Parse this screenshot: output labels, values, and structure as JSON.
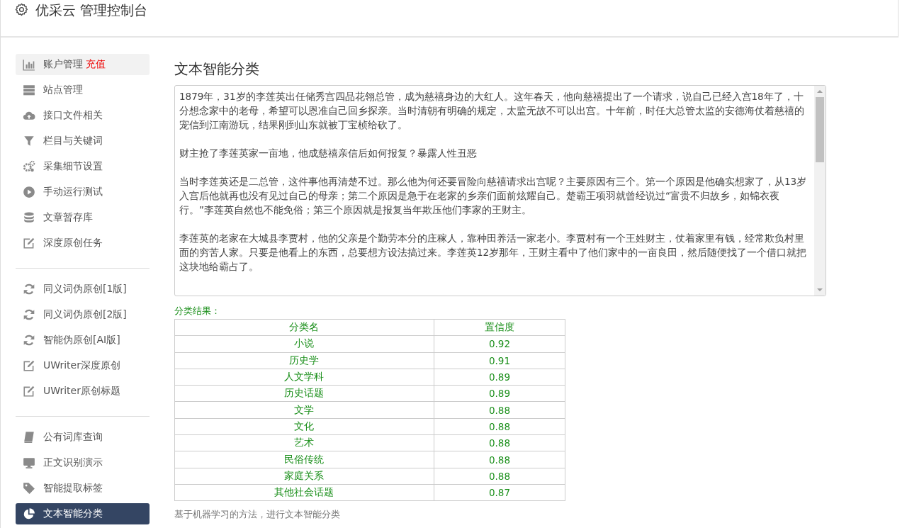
{
  "header": {
    "title": "优采云 管理控制台"
  },
  "sidebar": {
    "groups": [
      [
        {
          "label": "账户管理",
          "badge": "充值",
          "selected": false,
          "hover": true
        },
        {
          "label": "站点管理",
          "selected": false,
          "hover": false
        },
        {
          "label": "接口文件相关",
          "selected": false,
          "hover": false
        },
        {
          "label": "栏目与关键词",
          "selected": false,
          "hover": false
        },
        {
          "label": "采集细节设置",
          "selected": false,
          "hover": false
        },
        {
          "label": "手动运行测试",
          "selected": false,
          "hover": false
        },
        {
          "label": "文章暂存库",
          "selected": false,
          "hover": false
        },
        {
          "label": "深度原创任务",
          "selected": false,
          "hover": false
        }
      ],
      [
        {
          "label": "同义词伪原创[1版]",
          "selected": false,
          "hover": false
        },
        {
          "label": "同义词伪原创[2版]",
          "selected": false,
          "hover": false
        },
        {
          "label": "智能伪原创[AI版]",
          "selected": false,
          "hover": false
        },
        {
          "label": "UWriter深度原创",
          "selected": false,
          "hover": false
        },
        {
          "label": "UWriter原创标题",
          "selected": false,
          "hover": false
        }
      ],
      [
        {
          "label": "公有词库查询",
          "selected": false,
          "hover": false
        },
        {
          "label": "正文识别演示",
          "selected": false,
          "hover": false
        },
        {
          "label": "智能提取标签",
          "selected": false,
          "hover": false
        },
        {
          "label": "文本智能分类",
          "selected": true,
          "hover": false
        }
      ]
    ]
  },
  "main": {
    "title": "文本智能分类",
    "text_input": {
      "paragraphs": [
        "1879年，31岁的李莲英出任储秀宫四品花翎总管，成为慈禧身边的大红人。这年春天，他向慈禧提出了一个请求，说自己已经入宫18年了，十分想念家中的老母，希望可以恩准自己回乡探亲。当时清朝有明确的规定，太监无故不可以出宫。十年前，时任大总管太监的安德海仗着慈禧的宠信到江南游玩，结果刚到山东就被丁宝桢给砍了。",
        "财主抢了李莲英家一亩地，他成慈禧亲信后如何报复？暴露人性丑恶",
        "当时李莲英还是二总管，这件事他再清楚不过。那么他为何还要冒险向慈禧请求出宫呢？主要原因有三个。第一个原因是他确实想家了，从13岁入宫后他就再也没有见过自己的母亲；第二个原因是急于在老家的乡亲们面前炫耀自己。楚霸王项羽就曾经说过“富贵不归故乡，如锦衣夜行。”李莲英自然也不能免俗；第三个原因就是报复当年欺压他们李家的王财主。",
        "李莲英的老家在大城县李贾村，他的父亲是个勤劳本分的庄稼人，靠种田养活一家老小。李贾村有一个王姓财主，仗着家里有钱，经常欺负村里面的穷苦人家。只要是他看上的东西，总要想方设法搞过来。李莲英12岁那年，王财主看中了他们家中的一亩良田，然后随便找了一个借口就把这块地给霸占了。"
      ]
    },
    "result_label": "分类结果：",
    "table": {
      "columns": [
        "分类名",
        "置信度"
      ],
      "rows": [
        [
          "小说",
          "0.92"
        ],
        [
          "历史学",
          "0.91"
        ],
        [
          "人文学科",
          "0.89"
        ],
        [
          "历史话题",
          "0.89"
        ],
        [
          "文学",
          "0.88"
        ],
        [
          "文化",
          "0.88"
        ],
        [
          "艺术",
          "0.88"
        ],
        [
          "民俗传统",
          "0.88"
        ],
        [
          "家庭关系",
          "0.88"
        ],
        [
          "其他社会话题",
          "0.87"
        ]
      ]
    },
    "footnote": "基于机器学习的方法，进行文本智能分类"
  }
}
